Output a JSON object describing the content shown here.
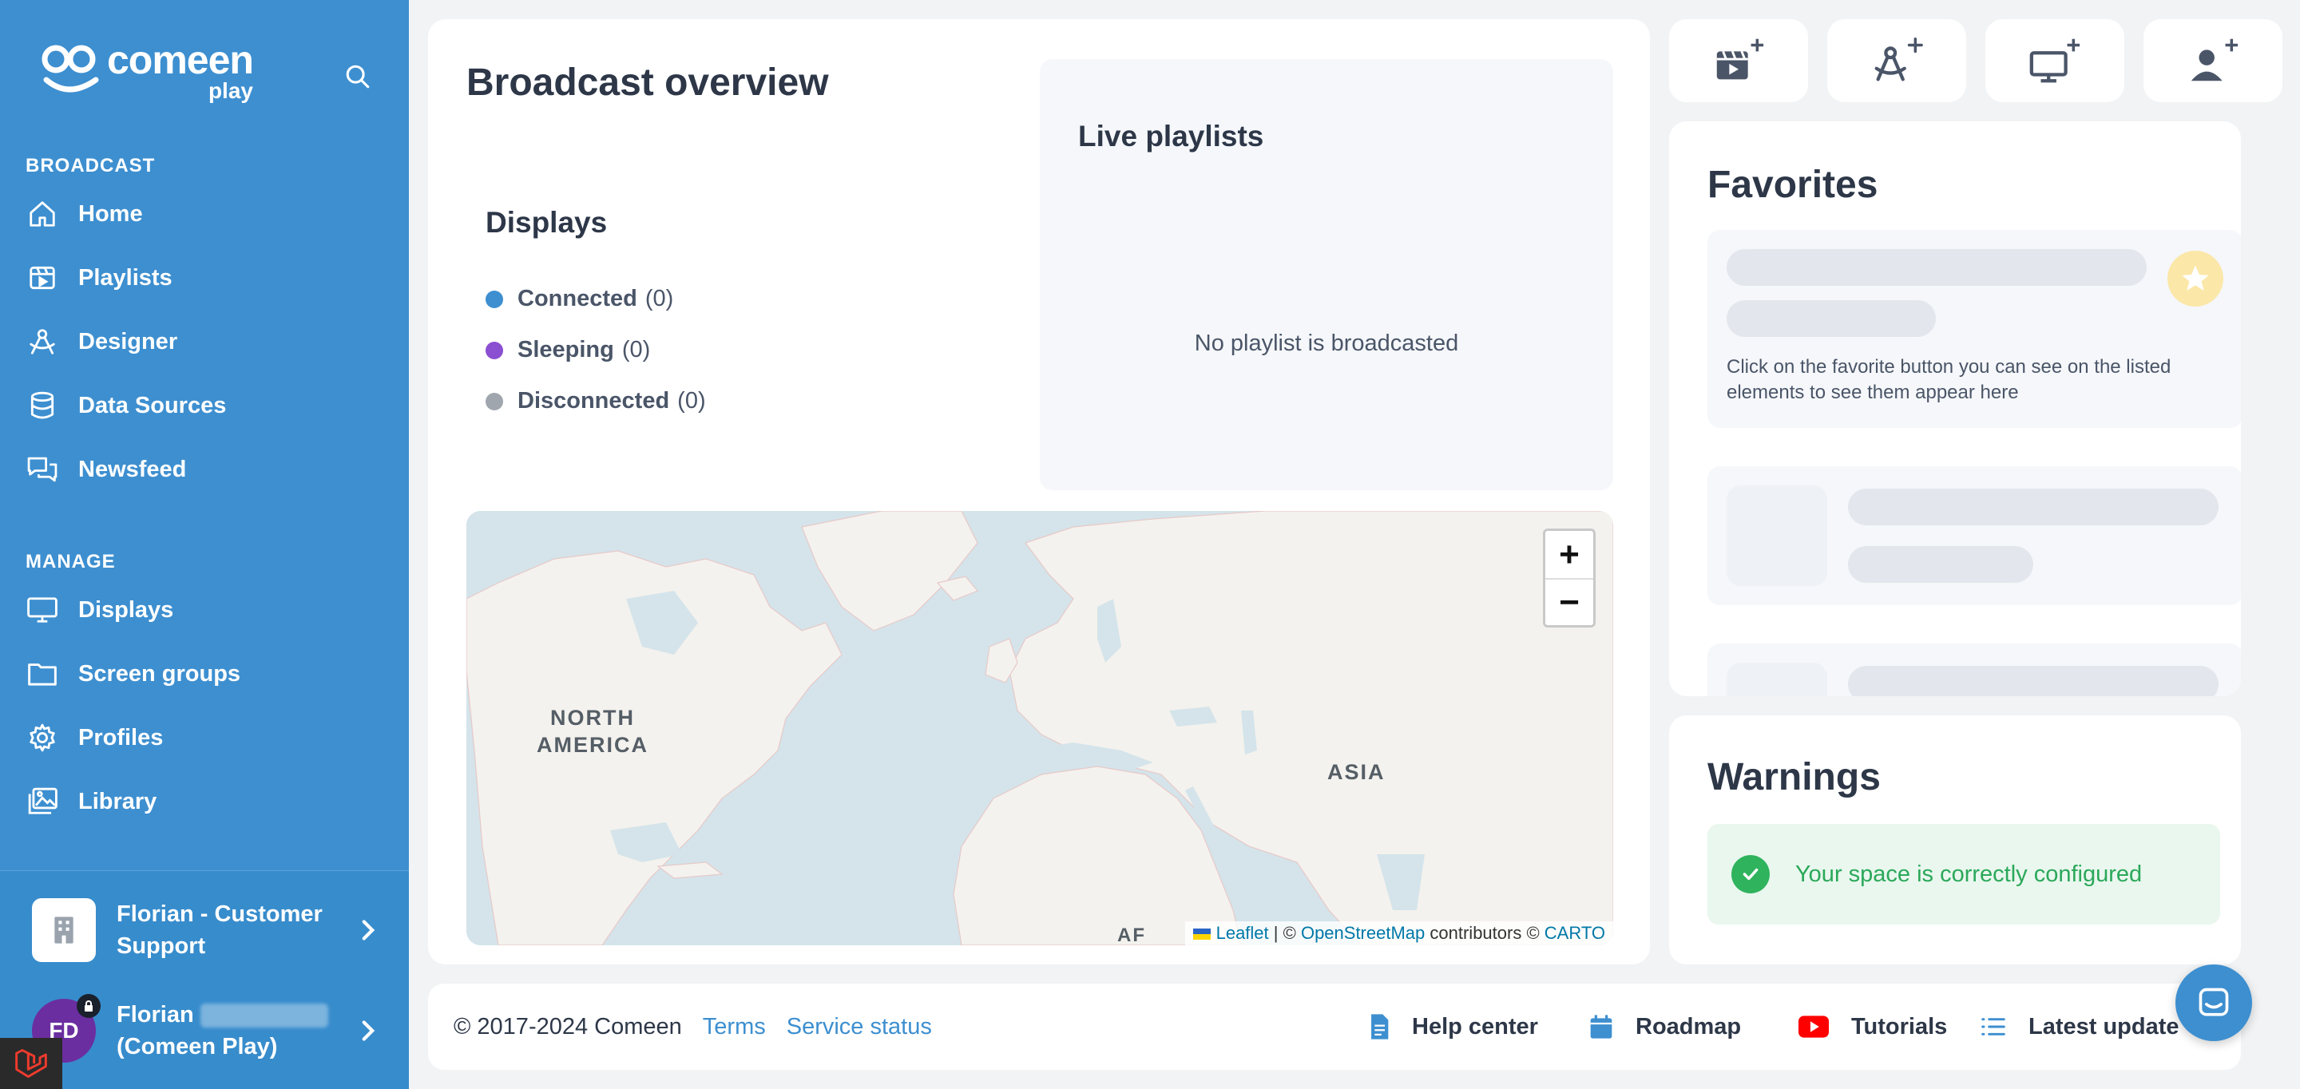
{
  "brand": {
    "name": "comeen",
    "sub": "play"
  },
  "sidebar": {
    "section_broadcast": "BROADCAST",
    "section_manage": "MANAGE",
    "broadcast_items": [
      {
        "label": "Home",
        "icon": "home-icon"
      },
      {
        "label": "Playlists",
        "icon": "playlists-icon"
      },
      {
        "label": "Designer",
        "icon": "designer-icon"
      },
      {
        "label": "Data Sources",
        "icon": "database-icon"
      },
      {
        "label": "Newsfeed",
        "icon": "newsfeed-icon"
      }
    ],
    "manage_items": [
      {
        "label": "Displays",
        "icon": "monitor-icon"
      },
      {
        "label": "Screen groups",
        "icon": "folder-icon"
      },
      {
        "label": "Profiles",
        "icon": "gear-icon"
      },
      {
        "label": "Library",
        "icon": "library-icon"
      }
    ],
    "org": {
      "line1": "Florian - Customer",
      "line2": "Support"
    },
    "user": {
      "initials": "FD",
      "line1": "Florian",
      "line2": "(Comeen Play)"
    }
  },
  "overview": {
    "title": "Broadcast overview",
    "displays_title": "Displays",
    "legend": [
      {
        "label": "Connected",
        "count": "(0)",
        "color": "#3d8fd0"
      },
      {
        "label": "Sleeping",
        "count": "(0)",
        "color": "#8b4fd1"
      },
      {
        "label": "Disconnected",
        "count": "(0)",
        "color": "#a0a6ad"
      }
    ],
    "live_title": "Live playlists",
    "live_empty": "No playlist is broadcasted"
  },
  "map": {
    "zoom_in": "+",
    "zoom_out": "−",
    "labels": {
      "north_america_1": "NORTH",
      "north_america_2": "AMERICA",
      "asia": "ASIA",
      "africa_partial": "AF"
    },
    "attribution": {
      "leaflet": "Leaflet",
      "sep": "| ©",
      "osm": "OpenStreetMap",
      "contrib": "contributors ©",
      "carto": "CARTO"
    }
  },
  "favorites": {
    "title": "Favorites",
    "hint": "Click on the favorite button you can see on the listed elements to see them appear here"
  },
  "warnings": {
    "title": "Warnings",
    "ok_message": "Your space is correctly configured"
  },
  "footer": {
    "copyright": "© 2017-2024 Comeen",
    "terms": "Terms",
    "status": "Service status",
    "help": "Help center",
    "roadmap": "Roadmap",
    "tutorials": "Tutorials",
    "latest": "Latest update"
  },
  "colors": {
    "sidebar": "#3d8fd0",
    "success": "#2fb35d",
    "link": "#3d8fd0"
  }
}
